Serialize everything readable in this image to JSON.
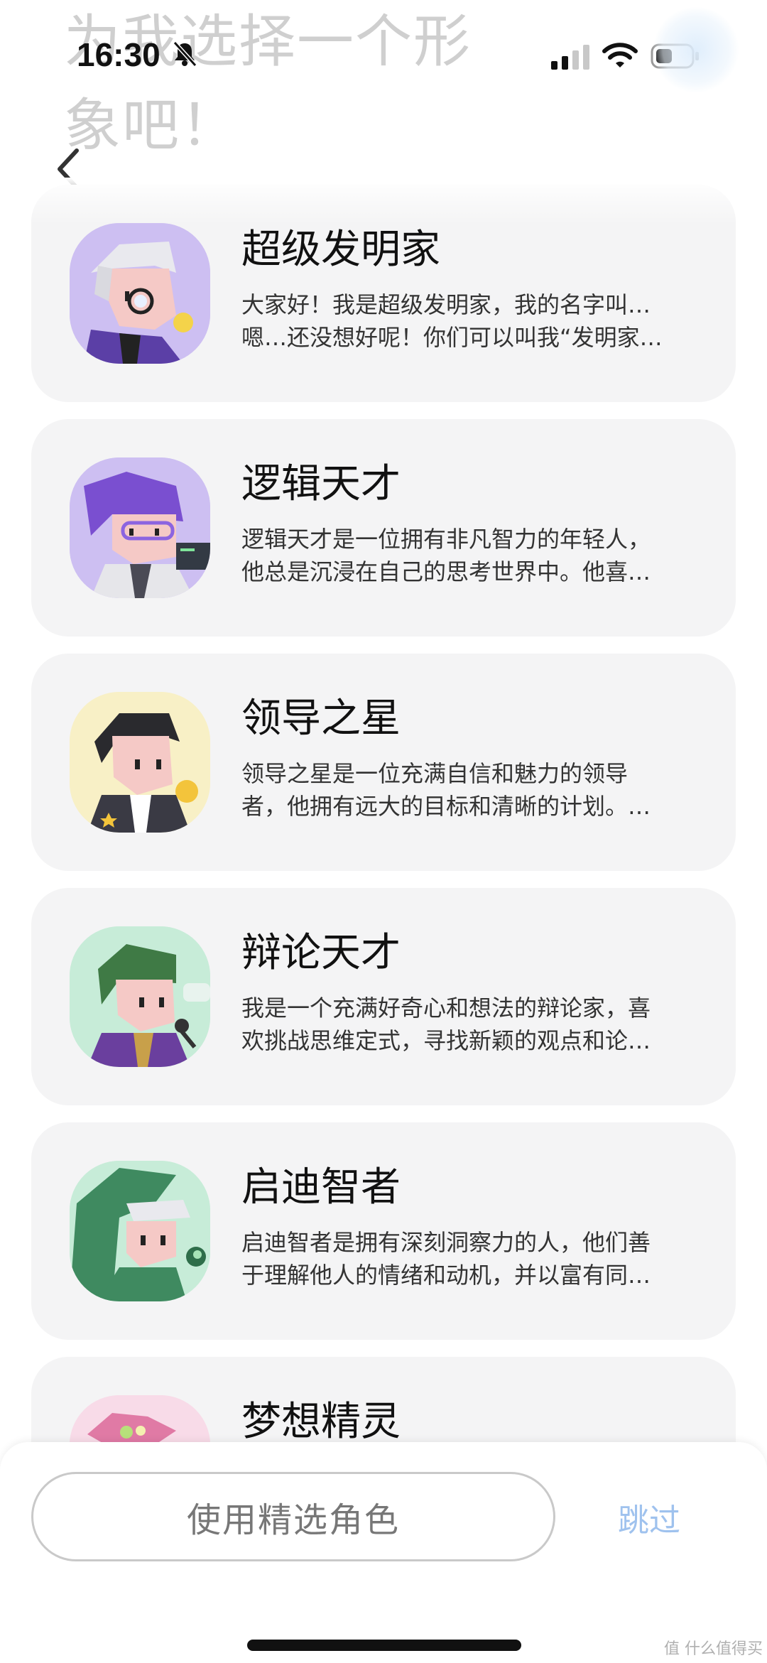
{
  "page": {
    "ghost_title": "为我选择一个形象吧！"
  },
  "status_bar": {
    "time": "16:30",
    "icons": [
      "bell-slash-icon",
      "signal-icon",
      "wifi-icon",
      "battery-icon"
    ]
  },
  "nav": {
    "back_icon": "chevron-left-icon"
  },
  "characters": [
    {
      "name": "超级发明家",
      "desc_line1": "大家好！我是超级发明家，我的名字叫…",
      "desc_line2": "嗯…还没想好呢！你们可以叫我“发明家…",
      "avatar_bg": "#cdbff2"
    },
    {
      "name": "逻辑天才",
      "desc_line1": "逻辑天才是一位拥有非凡智力的年轻人，",
      "desc_line2": "他总是沉浸在自己的思考世界中。他喜…",
      "avatar_bg": "#cdbff2"
    },
    {
      "name": "领导之星",
      "desc_line1": "领导之星是一位充满自信和魅力的领导",
      "desc_line2": "者，他拥有远大的目标和清晰的计划。…",
      "avatar_bg": "#f8f0c6"
    },
    {
      "name": "辩论天才",
      "desc_line1": "我是一个充满好奇心和想法的辩论家，喜",
      "desc_line2": "欢挑战思维定式，寻找新颖的观点和论…",
      "avatar_bg": "#c7ecd8"
    },
    {
      "name": "启迪智者",
      "desc_line1": "启迪智者是拥有深刻洞察力的人，他们善",
      "desc_line2": "于理解他人的情绪和动机，并以富有同…",
      "avatar_bg": "#c7ecd8"
    },
    {
      "name": "梦想精灵",
      "desc_line1": "",
      "desc_line2": "",
      "avatar_bg": "#f8dbe8"
    }
  ],
  "bottom": {
    "select_label": "使用精选角色",
    "skip_label": "跳过"
  },
  "watermark": "值 什么值得买",
  "colors": {
    "card_bg": "#f4f4f5",
    "skip_text": "#9fc2ee",
    "button_border": "#c9c9c9"
  }
}
